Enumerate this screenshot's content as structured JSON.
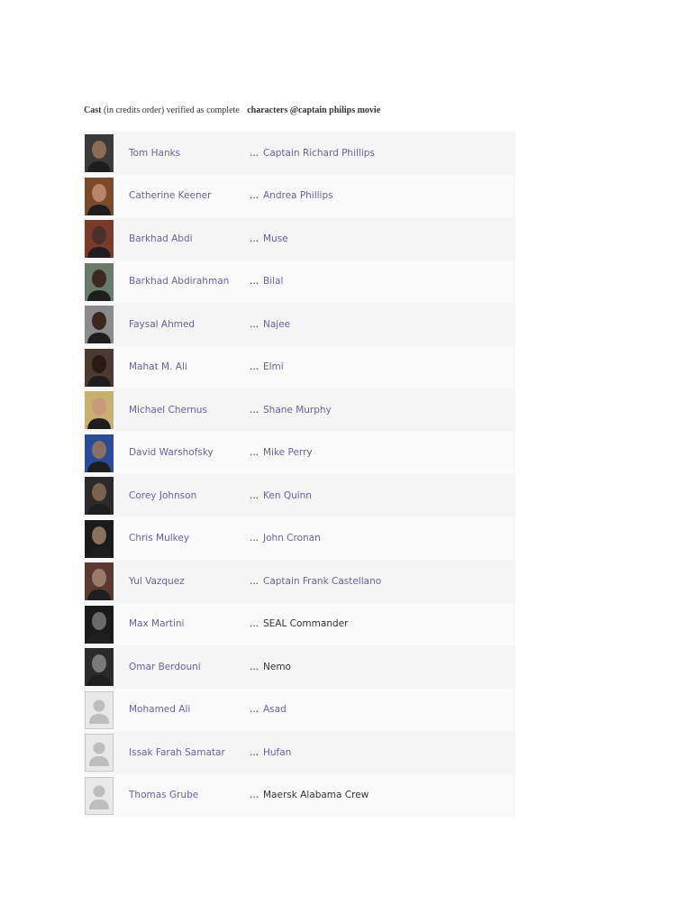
{
  "heading": {
    "cast_label": "Cast",
    "credits_note": "(in credits order) verified as complete",
    "title": "characters @captain philips movie"
  },
  "cast": [
    {
      "actor": "Tom Hanks",
      "character": "Captain Richard Phillips",
      "char_link": true,
      "photo": "photo",
      "tone": "#8a6b55",
      "bg": "#3a3a3a"
    },
    {
      "actor": "Catherine Keener",
      "character": "Andrea Phillips",
      "char_link": true,
      "photo": "photo",
      "tone": "#b8856a",
      "bg": "#7a4a2a"
    },
    {
      "actor": "Barkhad Abdi",
      "character": "Muse",
      "char_link": true,
      "photo": "photo",
      "tone": "#4a3028",
      "bg": "#7a3a2a"
    },
    {
      "actor": "Barkhad Abdirahman",
      "character": "Bilal",
      "char_link": true,
      "photo": "photo",
      "tone": "#3a2a22",
      "bg": "#6a7a6a"
    },
    {
      "actor": "Faysal Ahmed",
      "character": "Najee",
      "char_link": true,
      "photo": "photo",
      "tone": "#3a2820",
      "bg": "#8a8a8a"
    },
    {
      "actor": "Mahat M. Ali",
      "character": "Elmi",
      "char_link": true,
      "photo": "photo",
      "tone": "#2a1a14",
      "bg": "#4a3a30"
    },
    {
      "actor": "Michael Chernus",
      "character": "Shane Murphy",
      "char_link": true,
      "photo": "photo",
      "tone": "#c89a78",
      "bg": "#c8b070"
    },
    {
      "actor": "David Warshofsky",
      "character": "Mike Perry",
      "char_link": true,
      "photo": "photo",
      "tone": "#8a7060",
      "bg": "#2a4a9a"
    },
    {
      "actor": "Corey Johnson",
      "character": "Ken Quinn",
      "char_link": true,
      "photo": "photo",
      "tone": "#7a6050",
      "bg": "#2a2a2a"
    },
    {
      "actor": "Chris Mulkey",
      "character": "John Cronan",
      "char_link": true,
      "photo": "photo",
      "tone": "#8a7060",
      "bg": "#1a1a1a"
    },
    {
      "actor": "Yul Vazquez",
      "character": "Captain Frank Castellano",
      "char_link": true,
      "photo": "photo",
      "tone": "#9a7a68",
      "bg": "#5a3a30"
    },
    {
      "actor": "Max Martini",
      "character": "SEAL Commander",
      "char_link": false,
      "photo": "photo",
      "tone": "#6a6a6a",
      "bg": "#1a1a1a"
    },
    {
      "actor": "Omar Berdouni",
      "character": "Nemo",
      "char_link": false,
      "photo": "photo",
      "tone": "#7a7a7a",
      "bg": "#2a2a2a"
    },
    {
      "actor": "Mohamed Ali",
      "character": "Asad",
      "char_link": true,
      "photo": "placeholder"
    },
    {
      "actor": "Issak Farah Samatar",
      "character": "Hufan",
      "char_link": true,
      "photo": "placeholder"
    },
    {
      "actor": "Thomas Grube",
      "character": "Maersk Alabama Crew",
      "char_link": false,
      "photo": "placeholder"
    }
  ],
  "ellipsis": "..."
}
